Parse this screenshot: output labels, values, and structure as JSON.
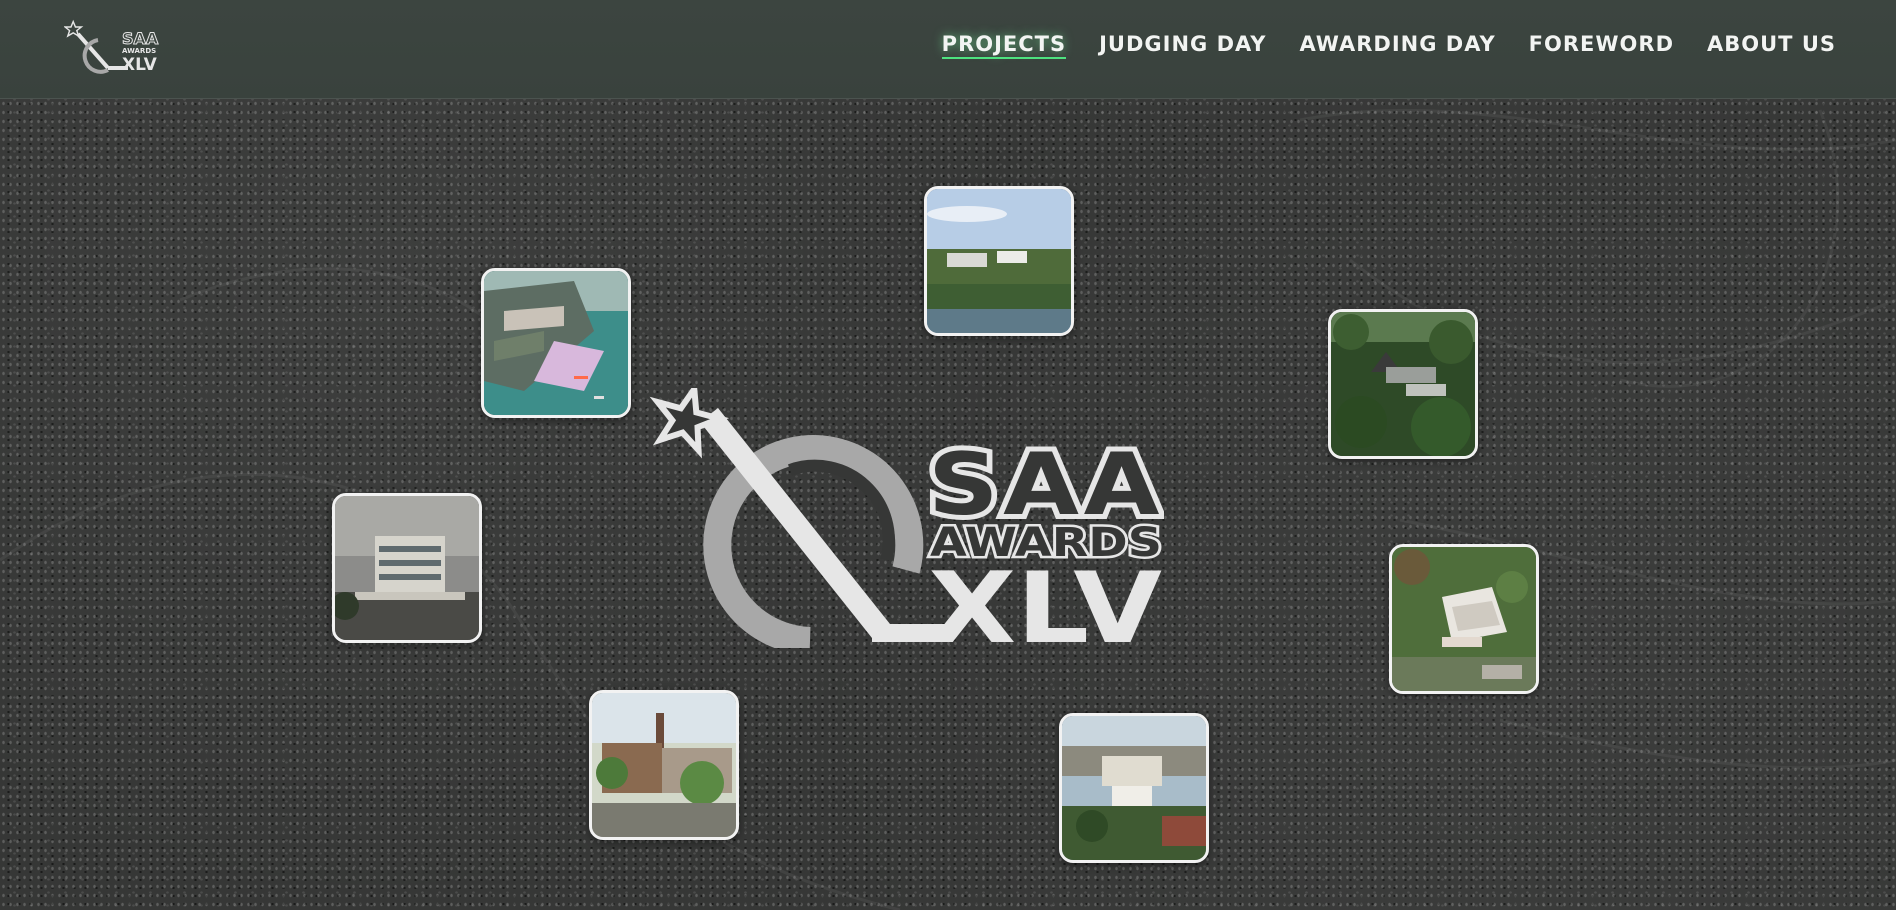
{
  "header": {
    "logo": {
      "name": "SAA AWARDS XLV",
      "text_top": "SAA",
      "text_mid": "AWARDS",
      "text_bottom": "XLV"
    },
    "nav": [
      {
        "label": "PROJECTS",
        "active": true
      },
      {
        "label": "JUDGING DAY",
        "active": false
      },
      {
        "label": "AWARDING DAY",
        "active": false
      },
      {
        "label": "FOREWORD",
        "active": false
      },
      {
        "label": "ABOUT US",
        "active": false
      }
    ],
    "accent_color": "#4ee27f"
  },
  "hero": {
    "logo": {
      "text_top": "SAA",
      "text_mid": "AWARDS",
      "text_bottom": "XLV"
    },
    "projects": [
      {
        "name": "waterfront-complex-render"
      },
      {
        "name": "riverside-landscape-render"
      },
      {
        "name": "forest-resort-render"
      },
      {
        "name": "glass-office-building-render"
      },
      {
        "name": "hillside-villa-render"
      },
      {
        "name": "heritage-chimney-render"
      },
      {
        "name": "urban-campus-render"
      }
    ]
  },
  "colors": {
    "background": "#363736",
    "header_bg": "#3c4540",
    "logo_light": "#e6e6e6",
    "logo_gray": "#a8a8a8"
  }
}
